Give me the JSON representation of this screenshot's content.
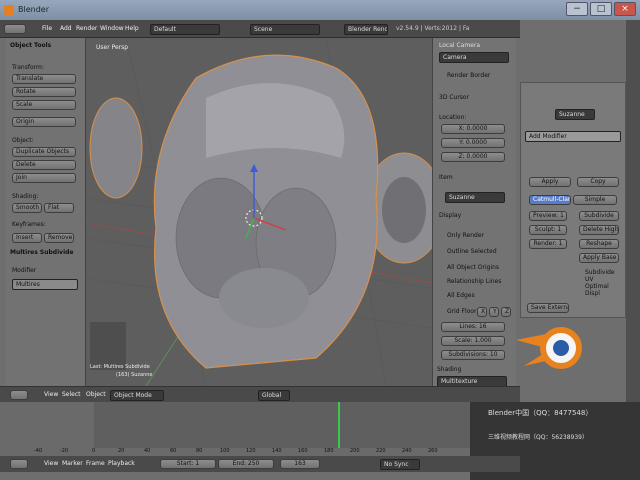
{
  "window": {
    "title": "Blender",
    "btn_min": "−",
    "btn_max": "□",
    "btn_close": "×"
  },
  "menubar": {
    "items": [
      "File",
      "Add",
      "Render",
      "Window",
      "Help"
    ],
    "screen": "Default",
    "scene": "Scene",
    "engine": "Blender Render",
    "stats": "v2.54.9 | Verts:2012 | Fa"
  },
  "toolshelf": {
    "title": "Object Tools",
    "transform": "Transform:",
    "translate": "Translate",
    "rotate": "Rotate",
    "scale": "Scale",
    "origin": "Origin",
    "object": "Object:",
    "duplicate": "Duplicate Objects",
    "delete": "Delete",
    "join": "Join",
    "shading": "Shading:",
    "smooth": "Smooth",
    "flat": "Flat",
    "keyframes": "Keyframes:",
    "insert": "Insert",
    "remove": "Remove",
    "op_title": "Multires Subdivide",
    "modifier": "Modifier",
    "multires": "Multires"
  },
  "viewport": {
    "label": "User Persp",
    "last_op": "Last: Multires Subdivide",
    "obj_name": "(163) Suzanne"
  },
  "npanel": {
    "local_camera": "Local Camera",
    "camera": "Camera",
    "render_border": "Render Border",
    "cursor_title": "3D Cursor",
    "location": "Location:",
    "x": "X: 0.0000",
    "y": "Y: 0.0000",
    "z": "Z: 0.0000",
    "item_title": "Item",
    "item_name": "Suzanne",
    "display_title": "Display",
    "only_render": "Only Render",
    "outline_selected": "Outline Selected",
    "all_origins": "All Object Origins",
    "relationship_lines": "Relationship Lines",
    "all_edges": "All Edges",
    "grid_floor": "Grid Floor",
    "grid_x": "X",
    "grid_y": "Y",
    "grid_z": "Z",
    "lines": "Lines: 16",
    "scale": "Scale: 1.000",
    "subdivisions": "Subdivisions: 10",
    "shading": "Shading",
    "shading_mode": "Multitexture"
  },
  "props": {
    "object_name": "Suzanne",
    "add_modifier": "Add Modifier",
    "apply": "Apply",
    "copy": "Copy",
    "catmull": "Catmull-Clark",
    "simple": "Simple",
    "preview": "Preview: 1",
    "sculpt": "Sculpt: 1",
    "render": "Render: 1",
    "subdivide": "Subdivide",
    "delete_higher": "Delete Higher",
    "reshape": "Reshape",
    "apply_base": "Apply Base",
    "subdivide_uv": "Subdivide UV",
    "optimal_disp": "Optimal Displ",
    "save_external": "Save External"
  },
  "vpheader": {
    "view": "View",
    "select": "Select",
    "object": "Object",
    "mode": "Object Mode",
    "orientation": "Global"
  },
  "timeline": {
    "ticks": [
      "-40",
      "-20",
      "0",
      "20",
      "40",
      "60",
      "80",
      "100",
      "120",
      "140",
      "160",
      "180",
      "200",
      "220",
      "240",
      "260"
    ]
  },
  "tlheader": {
    "view": "View",
    "marker": "Marker",
    "frame": "Frame",
    "playback": "Playback",
    "start": "Start: 1",
    "end": "End: 250",
    "current": "163",
    "sync": "No Sync"
  },
  "watermark": {
    "line1": "Blender中国（QQ：8477548）",
    "line2": "三维视频教程网（QQ：56238939）"
  }
}
